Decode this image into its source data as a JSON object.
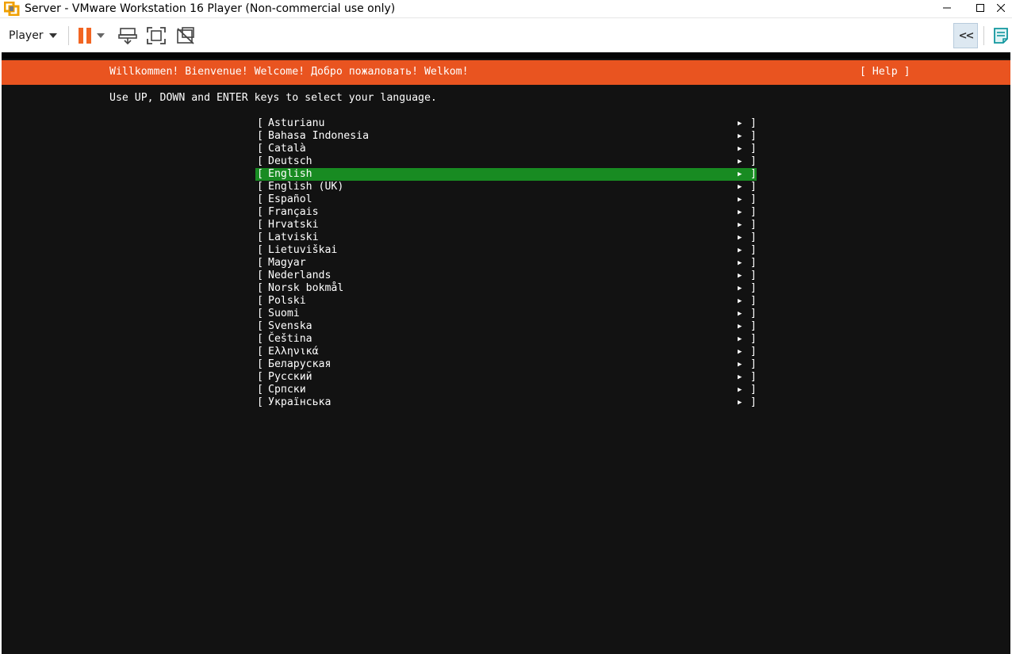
{
  "window": {
    "title": "Server - VMware Workstation 16 Player (Non-commercial use only)",
    "logo_icon": "vmware-logo-icon",
    "controls": [
      "minimize-icon",
      "maximize-icon",
      "close-icon"
    ]
  },
  "toolbar": {
    "player_label": "Player",
    "icons": [
      "pause-icon",
      "dropdown-icon",
      "send-ctrl-alt-del-icon",
      "fullscreen-icon",
      "unity-icon",
      "collapse-icon",
      "library-icon"
    ],
    "collapse_label": "<<",
    "accent_color": "#f26522"
  },
  "installer": {
    "header_color": "#e95420",
    "welcome": "Willkommen! Bienvenue! Welcome! Добро пожаловать! Welkom!",
    "help": "[ Help ]",
    "instructions": "Use UP, DOWN and ENTER keys to select your language.",
    "selected_color": "#188b22",
    "bracket_open": "[",
    "bracket_close": "]",
    "arrow": "▶",
    "languages": [
      {
        "name": "Asturianu",
        "selected": false
      },
      {
        "name": "Bahasa Indonesia",
        "selected": false
      },
      {
        "name": "Català",
        "selected": false
      },
      {
        "name": "Deutsch",
        "selected": false
      },
      {
        "name": "English",
        "selected": true
      },
      {
        "name": "English (UK)",
        "selected": false
      },
      {
        "name": "Español",
        "selected": false
      },
      {
        "name": "Français",
        "selected": false
      },
      {
        "name": "Hrvatski",
        "selected": false
      },
      {
        "name": "Latviski",
        "selected": false
      },
      {
        "name": "Lietuviškai",
        "selected": false
      },
      {
        "name": "Magyar",
        "selected": false
      },
      {
        "name": "Nederlands",
        "selected": false
      },
      {
        "name": "Norsk bokmål",
        "selected": false
      },
      {
        "name": "Polski",
        "selected": false
      },
      {
        "name": "Suomi",
        "selected": false
      },
      {
        "name": "Svenska",
        "selected": false
      },
      {
        "name": "Čeština",
        "selected": false
      },
      {
        "name": "Ελληνικά",
        "selected": false
      },
      {
        "name": "Беларуская",
        "selected": false
      },
      {
        "name": "Русский",
        "selected": false
      },
      {
        "name": "Српски",
        "selected": false
      },
      {
        "name": "Українська",
        "selected": false
      }
    ]
  }
}
